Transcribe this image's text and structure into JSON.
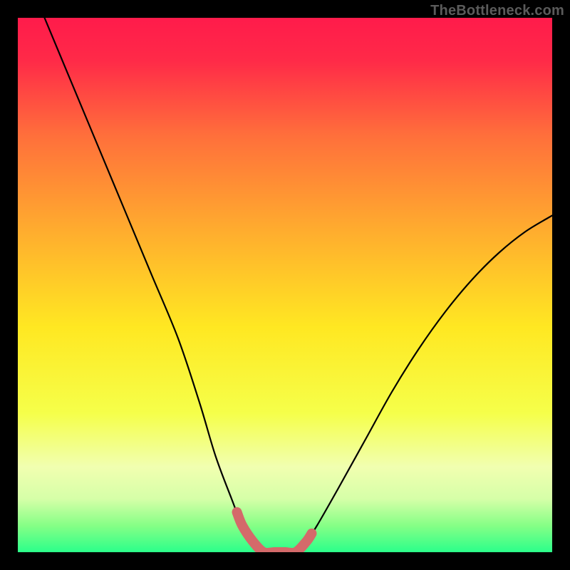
{
  "watermark": "TheBottleneck.com",
  "chart_data": {
    "type": "line",
    "title": "",
    "xlabel": "",
    "ylabel": "",
    "xlim": [
      0,
      100
    ],
    "ylim": [
      0,
      100
    ],
    "x": [
      5,
      10,
      15,
      20,
      25,
      30,
      34,
      37,
      40,
      42,
      44,
      46,
      48,
      50,
      52,
      54,
      56,
      60,
      65,
      70,
      75,
      80,
      85,
      90,
      95,
      100
    ],
    "values": [
      100,
      88,
      76,
      64,
      52,
      40,
      28,
      18,
      10,
      5,
      2,
      0,
      0,
      0,
      0,
      2,
      5,
      12,
      21,
      30,
      38,
      45,
      51,
      56,
      60,
      63
    ],
    "highlight_range_x": [
      41,
      55
    ],
    "background": "vertical gradient red→orange→yellow→pale-yellow→green",
    "gradient_stops": [
      {
        "pos": 0.0,
        "color": "#ff1b4b"
      },
      {
        "pos": 0.08,
        "color": "#ff2a48"
      },
      {
        "pos": 0.22,
        "color": "#ff6f3b"
      },
      {
        "pos": 0.4,
        "color": "#ffad2e"
      },
      {
        "pos": 0.58,
        "color": "#ffe822"
      },
      {
        "pos": 0.74,
        "color": "#f5ff4a"
      },
      {
        "pos": 0.84,
        "color": "#f1ffb0"
      },
      {
        "pos": 0.9,
        "color": "#d6ffa8"
      },
      {
        "pos": 0.95,
        "color": "#86ff86"
      },
      {
        "pos": 1.0,
        "color": "#2bff8a"
      }
    ],
    "curve_color": "#000000",
    "highlight_color": "#d46a6a"
  }
}
